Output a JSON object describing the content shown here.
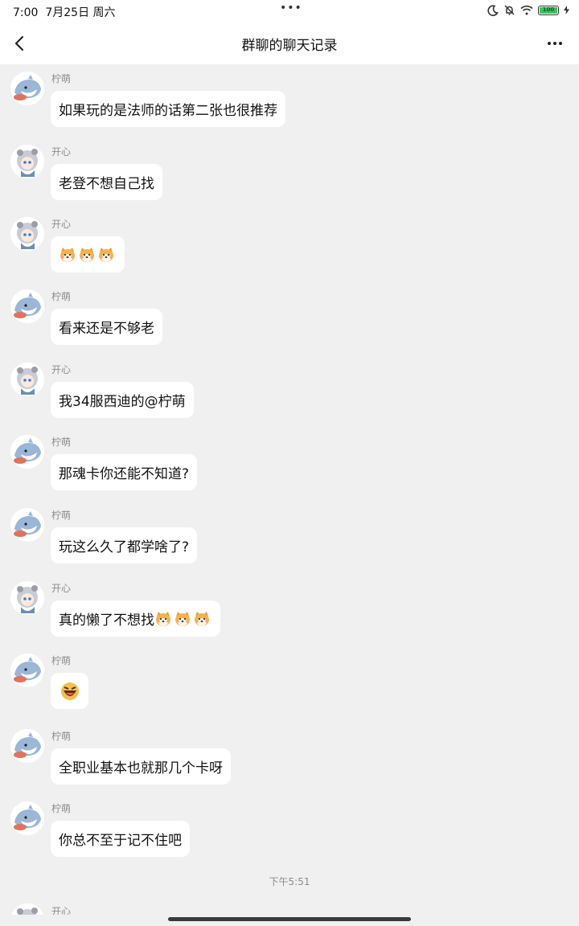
{
  "status_bar": {
    "time": "7:00",
    "date": "7月25日 周六",
    "dots": "•••",
    "battery": "100"
  },
  "nav": {
    "title": "群聊的聊天记录"
  },
  "messages": [
    {
      "sender": "柠萌",
      "text": "如果玩的是法师的话第二张也很推荐",
      "avatar": "shark"
    },
    {
      "sender": "开心",
      "text": "老登不想自己找",
      "avatar": "girl"
    },
    {
      "sender": "开心",
      "text": "",
      "emojis": [
        "shiba-emoji",
        "shiba-emoji",
        "shiba-emoji"
      ],
      "avatar": "girl"
    },
    {
      "sender": "柠萌",
      "text": "看来还是不够老",
      "avatar": "shark"
    },
    {
      "sender": "开心",
      "text": "我34服西迪的@柠萌",
      "avatar": "girl"
    },
    {
      "sender": "柠萌",
      "text": "那魂卡你还能不知道?",
      "avatar": "shark"
    },
    {
      "sender": "柠萌",
      "text": "玩这么久了都学啥了?",
      "avatar": "shark"
    },
    {
      "sender": "开心",
      "text": "真的懒了不想找",
      "emojis": [
        "shiba-emoji",
        "shiba-emoji",
        "shiba-emoji"
      ],
      "avatar": "girl"
    },
    {
      "sender": "柠萌",
      "text": "",
      "emojis": [
        "laughing-emoji"
      ],
      "avatar": "shark"
    },
    {
      "sender": "柠萌",
      "text": "全职业基本也就那几个卡呀",
      "avatar": "shark"
    },
    {
      "sender": "柠萌",
      "text": "你总不至于记不住吧",
      "avatar": "shark"
    }
  ],
  "timestamp": "下午5:51",
  "partial_message": {
    "sender": "开心"
  },
  "colors": {
    "background": "#f0f0f0",
    "bubble": "#ffffff",
    "sender_text": "#8c8c8c",
    "battery": "#3ec25f"
  }
}
